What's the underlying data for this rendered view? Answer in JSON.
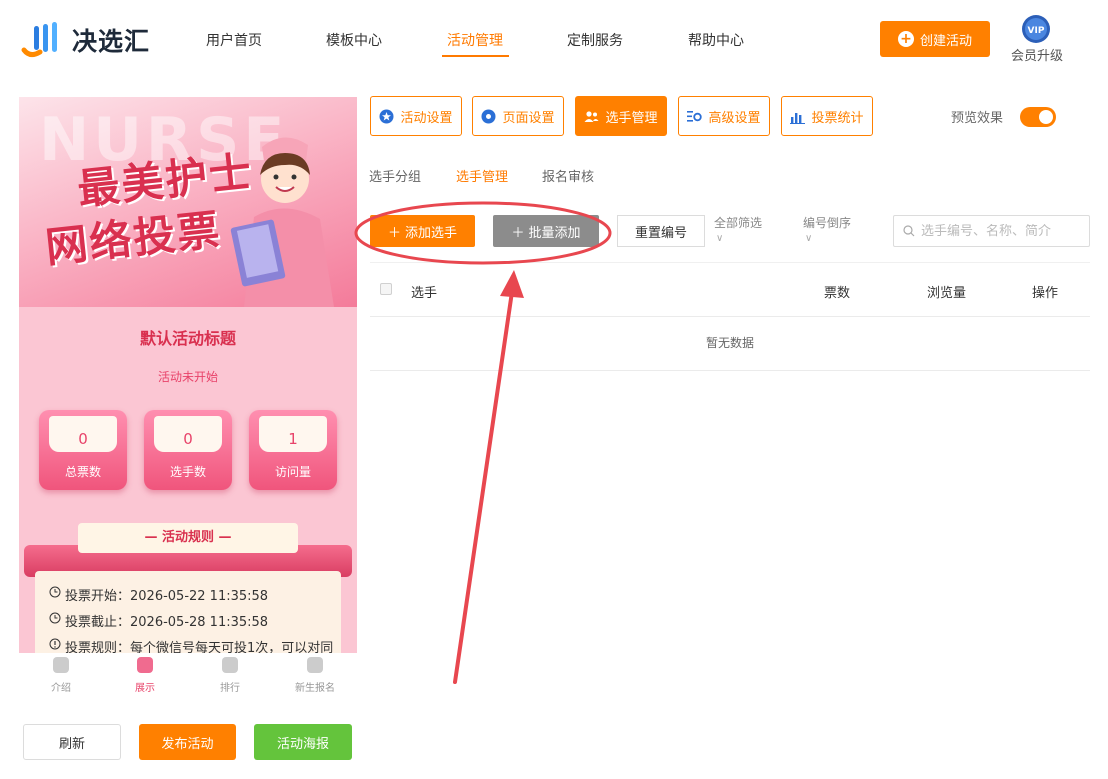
{
  "header": {
    "brand": "决选汇",
    "nav": [
      {
        "label": "用户首页",
        "active": false
      },
      {
        "label": "模板中心",
        "active": false
      },
      {
        "label": "活动管理",
        "active": true
      },
      {
        "label": "定制服务",
        "active": false
      },
      {
        "label": "帮助中心",
        "active": false
      }
    ],
    "create_label": "创建活动",
    "vip_badge": "VIP",
    "vip_label": "会员升级"
  },
  "preview": {
    "banner_bg_text": "NURSE",
    "banner_title_line1": "最美护士",
    "banner_title_line2": "网络投票",
    "activity_title": "默认活动标题",
    "status": "活动未开始",
    "stats": [
      {
        "value": "0",
        "label": "总票数"
      },
      {
        "value": "0",
        "label": "选手数"
      },
      {
        "value": "1",
        "label": "访问量"
      }
    ],
    "rules_title": "— 活动规则 —",
    "rules": [
      "投票开始：2026-05-22 11:35:58",
      "投票截止：2026-05-28 11:35:58",
      "投票规则：每个微信号每天可投1次，可以对同"
    ],
    "tabbar": [
      {
        "label": "介绍",
        "active": false
      },
      {
        "label": "展示",
        "active": true
      },
      {
        "label": "排行",
        "active": false
      },
      {
        "label": "新生报名",
        "active": false
      }
    ]
  },
  "bottom_buttons": {
    "refresh": "刷新",
    "publish": "发布活动",
    "poster": "活动海报"
  },
  "settings": {
    "buttons": [
      {
        "label": "活动设置",
        "icon": "star-icon",
        "active": false
      },
      {
        "label": "页面设置",
        "icon": "flower-icon",
        "active": false
      },
      {
        "label": "选手管理",
        "icon": "users-icon",
        "active": true
      },
      {
        "label": "高级设置",
        "icon": "gear-list-icon",
        "active": false
      },
      {
        "label": "投票统计",
        "icon": "bar-chart-icon",
        "active": false
      }
    ],
    "preview_label": "预览效果",
    "preview_on": true
  },
  "subtabs": [
    {
      "label": "选手分组",
      "active": false
    },
    {
      "label": "选手管理",
      "active": true
    },
    {
      "label": "报名审核",
      "active": false
    }
  ],
  "toolbar": {
    "add_player": "添加选手",
    "batch_add": "批量添加",
    "reset_number": "重置编号",
    "filter": "全部筛选",
    "sort": "编号倒序",
    "search_placeholder": "选手编号、名称、简介"
  },
  "table": {
    "columns": [
      "选手",
      "票数",
      "浏览量",
      "操作"
    ],
    "empty_text": "暂无数据"
  },
  "colors": {
    "accent": "#ff8000",
    "success": "#64c43c",
    "annotation": "#e8474f"
  }
}
